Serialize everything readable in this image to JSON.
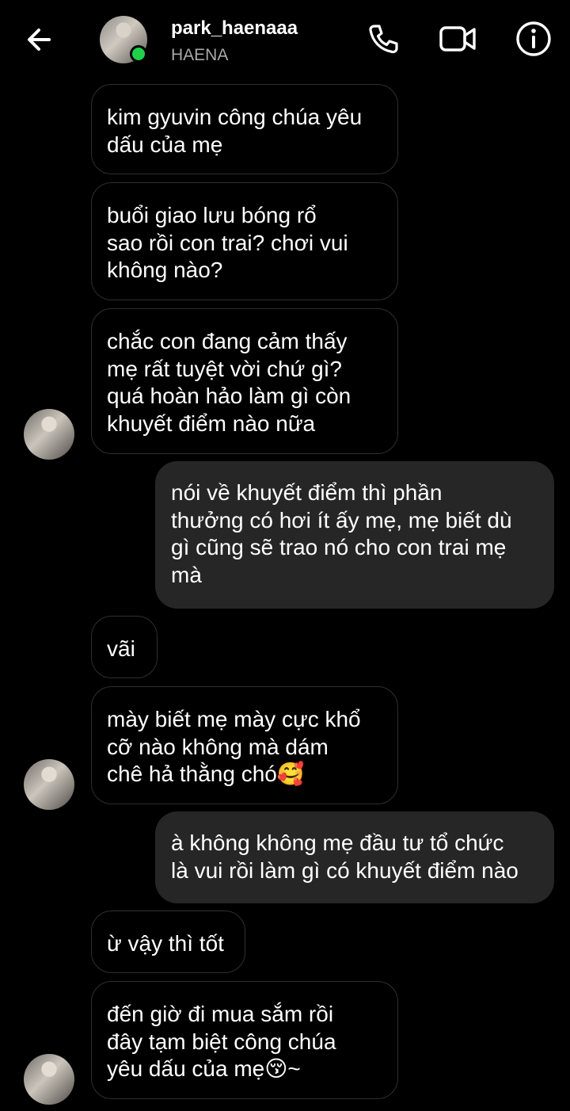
{
  "header": {
    "username": "park_haenaaa",
    "display_name": "HAENA",
    "online_color": "#1fd14a",
    "icons": [
      "back-arrow-icon",
      "phone-icon",
      "video-camera-icon",
      "info-icon"
    ]
  },
  "messages": [
    {
      "from": "them",
      "text": "kim gyuvin công chúa yêu\ndấu của mẹ"
    },
    {
      "from": "them",
      "text": "buổi giao lưu bóng rổ\nsao rồi con trai? chơi vui\nkhông nào?"
    },
    {
      "from": "them",
      "text": "chắc con đang cảm thấy\nmẹ rất tuyệt vời chứ gì?\nquá hoàn hảo làm gì còn\nkhuyết điểm nào nữa"
    },
    {
      "from": "me",
      "text": "nói về khuyết điểm thì phần\nthưởng có hơi ít ấy mẹ, mẹ biết dù\ngì cũng sẽ trao nó cho con trai mẹ\nmà"
    },
    {
      "from": "them",
      "text": "vãi"
    },
    {
      "from": "them",
      "text": "mày biết mẹ mày cực khổ\ncỡ nào không mà dám\nchê hả thằng chó🥰"
    },
    {
      "from": "me",
      "text": "à không không mẹ đầu tư tổ chức\nlà vui rồi làm gì có khuyết điểm nào"
    },
    {
      "from": "them",
      "text": "ừ vậy thì tốt"
    },
    {
      "from": "them",
      "text": "đến giờ đi mua sắm rồi\nđây tạm biệt công chúa\nyêu dấu của mẹ😚~"
    }
  ]
}
